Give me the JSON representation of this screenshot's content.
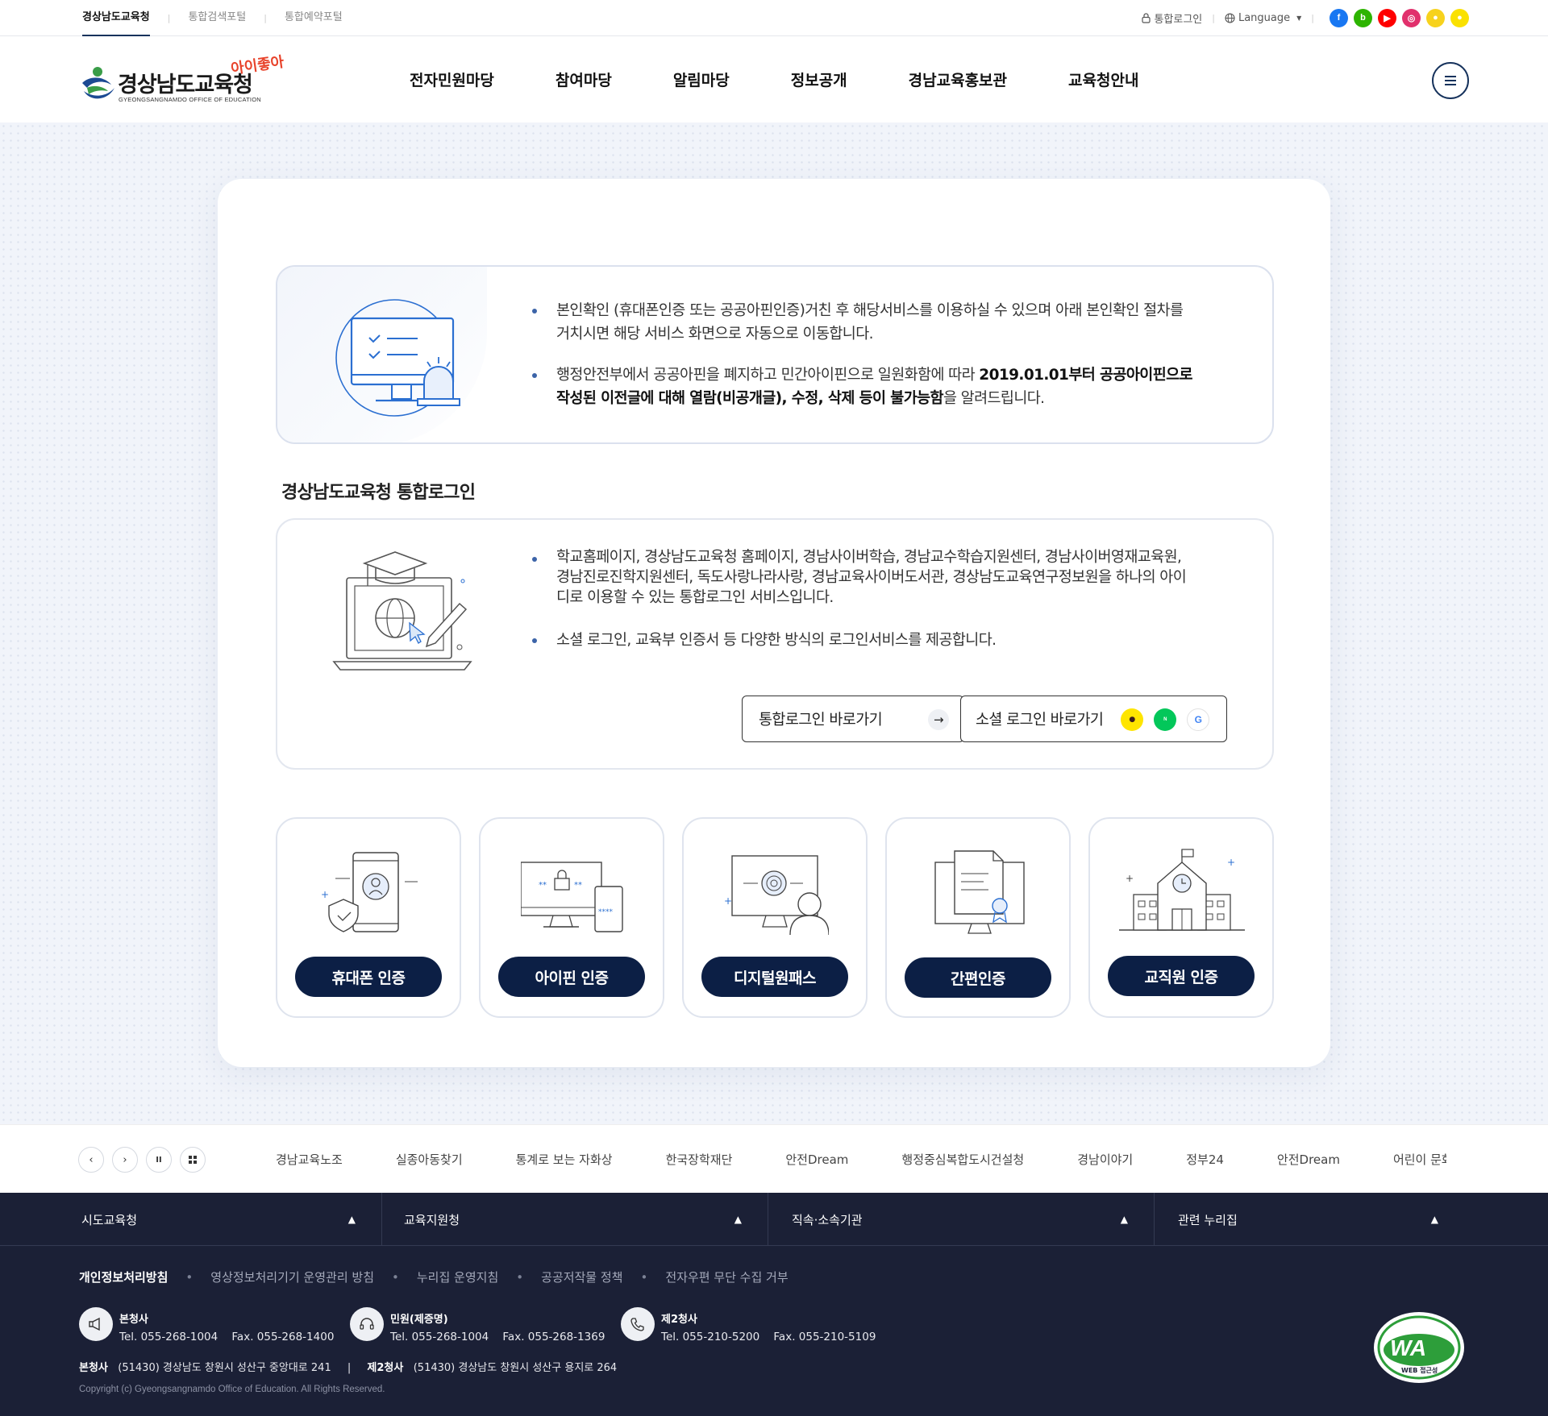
{
  "topbar": {
    "sites": [
      "경상남도교육청",
      "통합검색포털",
      "통합예약포털"
    ],
    "login": "통합로그인",
    "language": "Language",
    "sns": [
      {
        "name": "facebook-icon",
        "color": "#1877f2",
        "glyph": "f"
      },
      {
        "name": "blog-icon",
        "color": "#2db400",
        "glyph": "b"
      },
      {
        "name": "youtube-icon",
        "color": "#ff0000",
        "glyph": "▶"
      },
      {
        "name": "instagram-icon",
        "color": "#e1306c",
        "glyph": "◎"
      },
      {
        "name": "kakaostory-icon",
        "color": "#f7d21d",
        "glyph": "●"
      },
      {
        "name": "kakaotalk-icon",
        "color": "#fae100",
        "glyph": "●"
      }
    ]
  },
  "header": {
    "logo_name": "경상남도교육청",
    "logo_eng": "GYEONGSANGNAMDO OFFICE OF EDUCATION",
    "logo_slogan": "아이좋아",
    "gnb": [
      "전자민원마당",
      "참여마당",
      "알림마당",
      "정보공개",
      "경남교육홍보관",
      "교육청안내"
    ]
  },
  "notice": {
    "line1": "본인확인 (휴대폰인증 또는 공공아핀인증)거친 후  해당서비스를 이용하실 수 있으며 아래 본인확인 절차를",
    "line2": "거치시면 해당 서비스 화면으로 자동으로 이동합니다.",
    "line3_pre": "행정안전부에서 공공아핀을 폐지하고 민간아이핀으로 일원화함에 따라 ",
    "line3_bold": "2019.01.01부터 공공아이핀으로",
    "line4_bold": "작성된 이전글에 대해 열람(비공개글), 수정, 삭제 등이 불가능함",
    "line4_post": "을 알려드립니다."
  },
  "integrated": {
    "title": "경상남도교육청 통합로그인",
    "desc1_l1": "학교홈페이지, 경상남도교육청 홈페이지, 경남사이버학습, 경남교수학습지원센터, 경남사이버영재교육원,",
    "desc1_l2": " 경남진로진학지원센터, 독도사랑나라사랑, 경남교육사이버도서관, 경상남도교육연구정보원을 하나의 아이",
    "desc1_l3": "디로 이용할 수 있는 통합로그인 서비스입니다.",
    "desc2": "소셜 로그인, 교육부 인증서 등 다양한 방식의 로그인서비스를 제공합니다.",
    "btn_integrated": "통합로그인 바로가기",
    "btn_social": "소셜 로그인 바로가기"
  },
  "auth_methods": [
    "휴대폰 인증",
    "아이핀 인증",
    "디지털원패스",
    "간편인증",
    "교직원 인증"
  ],
  "banner": {
    "links": [
      "경남교육노조",
      "실종아동찾기",
      "통계로 보는 자화상",
      "한국장학재단",
      "안전Dream",
      "행정중심복합도시건설청",
      "경남이야기",
      "정부24",
      "안전Dream",
      "어린이 문화"
    ]
  },
  "footer": {
    "menus": [
      "시도교육청",
      "교육지원청",
      "직속·소속기관",
      "관련 누리집"
    ],
    "policies": [
      "개인정보처리방침",
      "영상정보처리기기 운영관리 방침",
      "누리집 운영지침",
      "공공저작물 정책",
      "전자우편 무단 수집 거부"
    ],
    "offices": [
      {
        "name": "본청사",
        "tel": "Tel. 055-268-1004",
        "fax": "Fax. 055-268-1400"
      },
      {
        "name": "민원(제증명)",
        "tel": "Tel. 055-268-1004",
        "fax": "Fax. 055-268-1369"
      },
      {
        "name": "제2청사",
        "tel": "Tel. 055-210-5200",
        "fax": "Fax. 055-210-5109"
      }
    ],
    "addr1_label": "본청사",
    "addr1": "(51430) 경상남도 창원시 성산구 중앙대로 241",
    "addr2_label": "제2청사",
    "addr2": "(51430) 경상남도 창원시 성산구 용지로 264",
    "copyright": "Copyright (c) Gyeongsangnamdo Office of Education. All Rights Reserved.",
    "wa_mark": "WA",
    "wa_sub": "WEB 접근성"
  }
}
